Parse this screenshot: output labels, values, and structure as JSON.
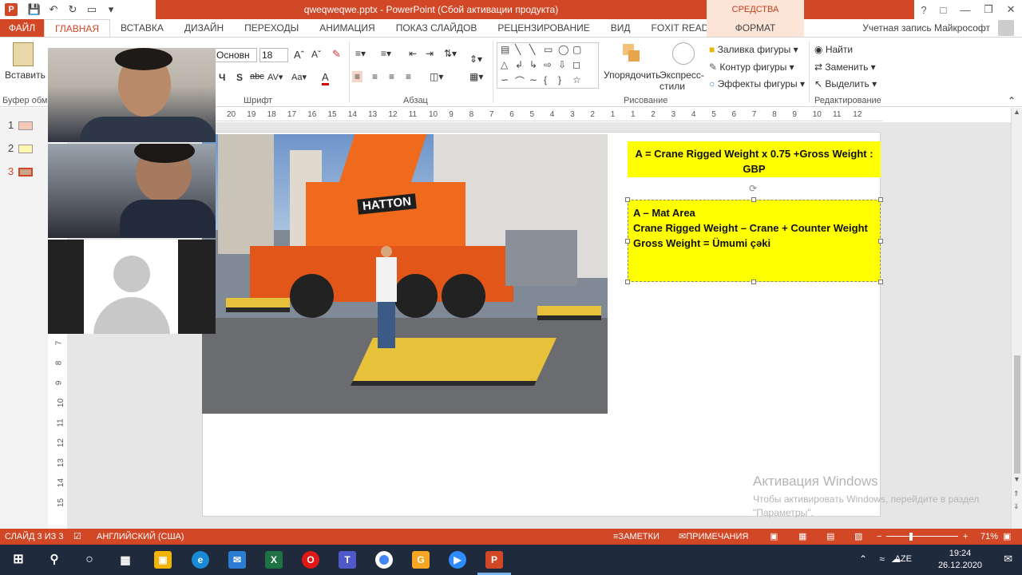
{
  "window": {
    "title": "qweqweqwe.pptx - PowerPoint (Сбой активации продукта)",
    "tools_tab": "СРЕДСТВА РИСОВАНИЯ",
    "account": "Учетная запись Майкрософт"
  },
  "tabs": [
    "ФАЙЛ",
    "ГЛАВНАЯ",
    "ВСТАВКА",
    "ДИЗАЙН",
    "ПЕРЕХОДЫ",
    "АНИМАЦИЯ",
    "ПОКАЗ СЛАЙДОВ",
    "РЕЦЕНЗИРОВАНИЕ",
    "ВИД",
    "FOXIT READER PDF",
    "ФОРМАТ"
  ],
  "ribbon": {
    "paste_label": "Вставить",
    "clipboard_label": "Буфер обме",
    "font_name": "Основн",
    "font_size": "18",
    "font_group": "Шрифт",
    "paragraph_group": "Абзац",
    "arrange_label": "Упорядочить",
    "quick_styles_label": "Экспресс-стили",
    "drawing_group": "Рисование",
    "shape_fill": "Заливка фигуры",
    "shape_outline": "Контур фигуры",
    "shape_effects": "Эффекты фигуры",
    "find": "Найти",
    "replace": "Заменить",
    "select": "Выделить",
    "editing_group": "Редактирование"
  },
  "slides": [
    {
      "num": "1"
    },
    {
      "num": "2"
    },
    {
      "num": "3"
    }
  ],
  "ruler_h": [
    "20",
    "19",
    "18",
    "17",
    "16",
    "15",
    "14",
    "13",
    "12",
    "11",
    "10",
    "9",
    "8",
    "7",
    "6",
    "5",
    "4",
    "3",
    "2",
    "1",
    "1",
    "2",
    "3",
    "4",
    "5",
    "6",
    "7",
    "8",
    "9",
    "10",
    "11",
    "12"
  ],
  "ruler_v": [
    "7",
    "8",
    "9",
    "10",
    "11",
    "12",
    "13",
    "14",
    "15"
  ],
  "slide": {
    "formula": "A = Crane Rigged Weight x 0.75 +Gross Weight : GBP",
    "line1": "A – Mat Area",
    "line2": "Crane Rigged Weight – Crane + Counter Weight",
    "line3": "Gross Weight = Ümumi çəki",
    "photo_brand": "HATTON"
  },
  "watermark": {
    "title": "Активация Windows",
    "text": "Чтобы активировать Windows, перейдите в раздел \"Параметры\"."
  },
  "status": {
    "slide": "СЛАЙД 3 ИЗ 3",
    "language": "АНГЛИЙСКИЙ (США)",
    "notes": "ЗАМЕТКИ",
    "comments": "ПРИМЕЧАНИЯ",
    "zoom": "71%"
  },
  "taskbar": {
    "lang": "AZE",
    "time": "19:24",
    "date": "26.12.2020"
  },
  "colors": {
    "accent": "#d24726",
    "highlight": "#ffff00"
  }
}
